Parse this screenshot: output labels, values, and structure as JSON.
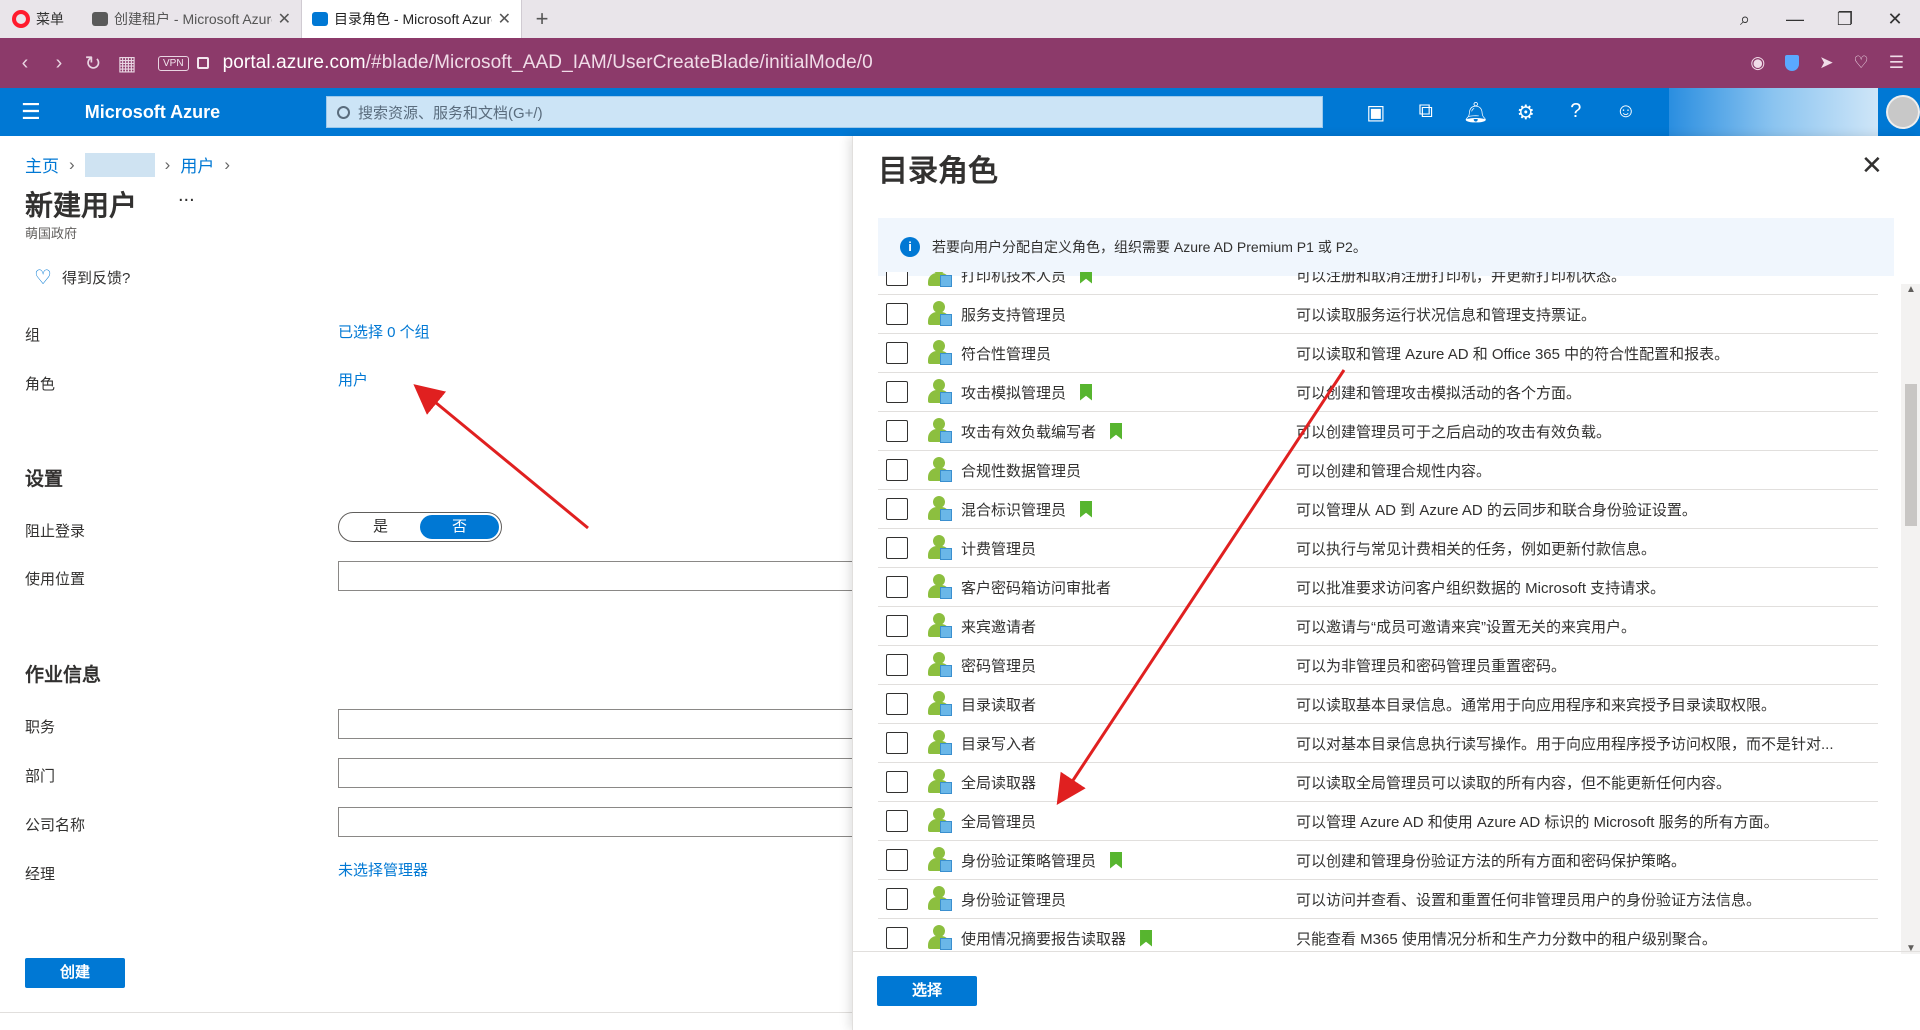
{
  "browser": {
    "menu_label": "菜单",
    "tabs": [
      {
        "title": "创建租户 - Microsoft Azure",
        "active": false
      },
      {
        "title": "目录角色 - Microsoft Azure",
        "active": true
      }
    ],
    "new_tab": "+",
    "url_domain": "portal.azure.com",
    "url_path": "/#blade/Microsoft_AAD_IAM/UserCreateBlade/initialMode/0",
    "vpn_badge": "VPN"
  },
  "azure_header": {
    "brand": "Microsoft Azure",
    "search_placeholder": "搜索资源、服务和文档(G+/)"
  },
  "left_blade": {
    "breadcrumb": [
      "主页",
      "用户"
    ],
    "title": "新建用户",
    "more": "...",
    "subtitle": "萌国政府",
    "feedback": "得到反馈?",
    "fields": {
      "group_label": "组",
      "group_value": "已选择 0 个组",
      "role_label": "角色",
      "role_value": "用户"
    },
    "settings": {
      "heading": "设置",
      "block_signin_label": "阻止登录",
      "toggle_yes": "是",
      "toggle_no": "否",
      "toggle_selected": "否",
      "usage_location_label": "使用位置"
    },
    "job": {
      "heading": "作业信息",
      "title_label": "职务",
      "department_label": "部门",
      "company_label": "公司名称",
      "manager_label": "经理",
      "manager_value": "未选择管理器"
    },
    "create_button": "创建"
  },
  "panel": {
    "title": "目录角色",
    "close": "✕",
    "info_icon": "info-icon",
    "info_text": "若要向用户分配自定义角色，组织需要 Azure AD Premium P1 或 P2。",
    "roles": [
      {
        "name": "打印机技术人员",
        "preview": true,
        "description": "可以注册和取消注册打印机，并更新打印机状态。",
        "checked": false
      },
      {
        "name": "服务支持管理员",
        "preview": false,
        "description": "可以读取服务运行状况信息和管理支持票证。",
        "checked": false
      },
      {
        "name": "符合性管理员",
        "preview": false,
        "description": "可以读取和管理 Azure AD 和 Office 365 中的符合性配置和报表。",
        "checked": false
      },
      {
        "name": "攻击模拟管理员",
        "preview": true,
        "description": "可以创建和管理攻击模拟活动的各个方面。",
        "checked": false
      },
      {
        "name": "攻击有效负载编写者",
        "preview": true,
        "description": "可以创建管理员可于之后启动的攻击有效负载。",
        "checked": false
      },
      {
        "name": "合规性数据管理员",
        "preview": false,
        "description": "可以创建和管理合规性内容。",
        "checked": false
      },
      {
        "name": "混合标识管理员",
        "preview": true,
        "description": "可以管理从 AD 到 Azure AD 的云同步和联合身份验证设置。",
        "checked": false
      },
      {
        "name": "计费管理员",
        "preview": false,
        "description": "可以执行与常见计费相关的任务，例如更新付款信息。",
        "checked": false
      },
      {
        "name": "客户密码箱访问审批者",
        "preview": false,
        "description": "可以批准要求访问客户组织数据的 Microsoft 支持请求。",
        "checked": false
      },
      {
        "name": "来宾邀请者",
        "preview": false,
        "description": "可以邀请与“成员可邀请来宾”设置无关的来宾用户。",
        "checked": false
      },
      {
        "name": "密码管理员",
        "preview": false,
        "description": "可以为非管理员和密码管理员重置密码。",
        "checked": false
      },
      {
        "name": "目录读取者",
        "preview": false,
        "description": "可以读取基本目录信息。通常用于向应用程序和来宾授予目录读取权限。",
        "checked": false
      },
      {
        "name": "目录写入者",
        "preview": false,
        "description": "可以对基本目录信息执行读写操作。用于向应用程序授予访问权限，而不是针对...",
        "checked": false
      },
      {
        "name": "全局读取器",
        "preview": false,
        "description": "可以读取全局管理员可以读取的所有内容，但不能更新任何内容。",
        "checked": false
      },
      {
        "name": "全局管理员",
        "preview": false,
        "description": "可以管理 Azure AD 和使用 Azure AD 标识的 Microsoft 服务的所有方面。",
        "checked": false
      },
      {
        "name": "身份验证策略管理员",
        "preview": true,
        "description": "可以创建和管理身份验证方法的所有方面和密码保护策略。",
        "checked": false
      },
      {
        "name": "身份验证管理员",
        "preview": false,
        "description": "可以访问并查看、设置和重置任何非管理员用户的身份验证方法信息。",
        "checked": false
      },
      {
        "name": "使用情况摘要报告读取器",
        "preview": true,
        "description": "只能查看 M365 使用情况分析和生产力分数中的租户级别聚合。",
        "checked": false
      }
    ],
    "select_button": "选择"
  },
  "colors": {
    "azure_blue": "#0078d4",
    "browser_bar": "#8c3a6a",
    "arrow": "#e02020",
    "role_icon_green": "#8cbf3f",
    "preview_bookmark": "#57b52f"
  }
}
